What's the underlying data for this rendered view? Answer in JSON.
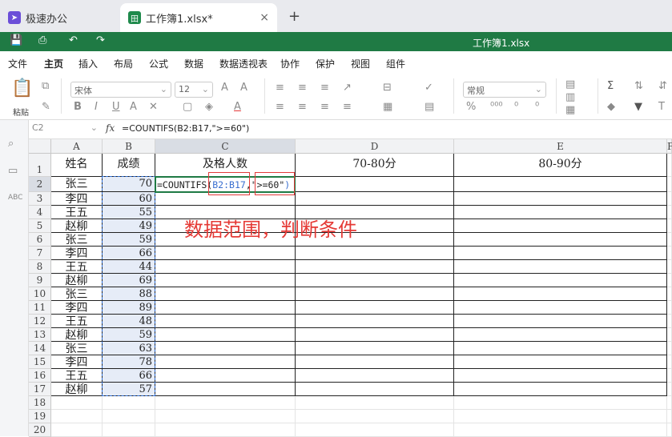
{
  "tabs": {
    "home_label": "极速办公",
    "file_label": "工作簿1.xlsx*",
    "close": "×",
    "new": "+"
  },
  "titlebar": {
    "title": "工作簿1.xlsx"
  },
  "menu": [
    "文件",
    "主页",
    "插入",
    "布局",
    "公式",
    "数据",
    "数据透视表",
    "协作",
    "保护",
    "视图",
    "组件"
  ],
  "menu_active": "主页",
  "ribbon": {
    "paste_label": "粘贴",
    "font_name": "宋体",
    "font_size": "12",
    "number_format": "常规"
  },
  "formula_bar": {
    "name_box": "C2",
    "fx": "fx",
    "formula": "=COUNTIFS(B2:B17,\">=60\")"
  },
  "columns": [
    "A",
    "B",
    "C",
    "D",
    "E",
    "F"
  ],
  "header_row": [
    "姓名",
    "成绩",
    "及格人数",
    "70-80分",
    "80-90分"
  ],
  "rows": [
    {
      "name": "张三",
      "score": "70"
    },
    {
      "name": "李四",
      "score": "60"
    },
    {
      "name": "王五",
      "score": "55"
    },
    {
      "name": "赵柳",
      "score": "49"
    },
    {
      "name": "张三",
      "score": "59"
    },
    {
      "name": "李四",
      "score": "66"
    },
    {
      "name": "王五",
      "score": "44"
    },
    {
      "name": "赵柳",
      "score": "69"
    },
    {
      "name": "张三",
      "score": "88"
    },
    {
      "name": "李四",
      "score": "89"
    },
    {
      "name": "王五",
      "score": "48"
    },
    {
      "name": "赵柳",
      "score": "59"
    },
    {
      "name": "张三",
      "score": "63"
    },
    {
      "name": "李四",
      "score": "78"
    },
    {
      "name": "王五",
      "score": "66"
    },
    {
      "name": "赵柳",
      "score": "57"
    }
  ],
  "row_numbers": [
    "1",
    "2",
    "3",
    "4",
    "5",
    "6",
    "7",
    "8",
    "9",
    "10",
    "11",
    "12",
    "13",
    "14",
    "15",
    "16",
    "17",
    "18",
    "19",
    "20"
  ],
  "c2_formula": {
    "prefix": "=COUNTIFS(",
    "range": "B2:B17",
    "comma": ",",
    "criteria": "\">=60\"",
    "suffix": ")"
  },
  "annotation": "数据范围，判断条件",
  "colors": {
    "accent": "#1f7a44",
    "annotation": "#e53935",
    "range": "#3a6fd0"
  }
}
